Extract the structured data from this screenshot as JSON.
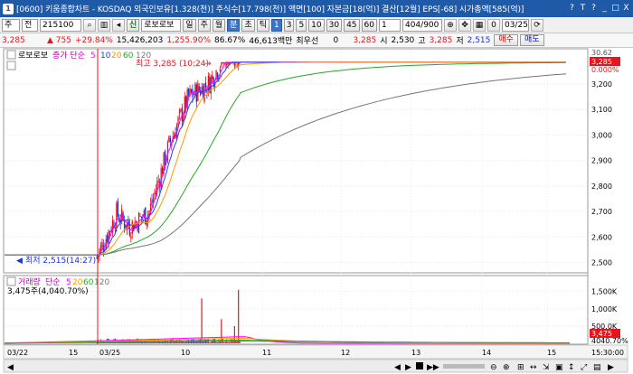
{
  "window": {
    "title": "[0600] 키움종합차트 - KOSDAQ 외국인보유[1.328(천)] 주식수[17.798(천)] 액면[100] 자본금[18(억)] 결산[12월] EPS[-68] 시가총액[585(억)]",
    "controls": [
      "?",
      "T",
      "?",
      "_",
      "□",
      "X"
    ]
  },
  "toolbar": {
    "market_label": "주",
    "mode_label": "전",
    "code": "215100",
    "search_icon": "search-icon",
    "period_icon": "bars-icon",
    "stock_name": "로보로보",
    "credit_badge": "신",
    "periods": [
      "일",
      "주",
      "월",
      "분",
      "초",
      "틱"
    ],
    "active_period": "분",
    "intervals": [
      "1",
      "3",
      "5",
      "10",
      "30",
      "45",
      "60"
    ],
    "active_interval": "1",
    "multiplier": "1",
    "count": "404/900",
    "date_checkbox": "0",
    "date": "03/25"
  },
  "quote": {
    "price": "3,285",
    "change": "▲ 755",
    "change_pct": "+29.84%",
    "volume": "15,426,203",
    "volume_pct": "1,255.90%",
    "ratio": "86.67%",
    "amount": "46,613백만",
    "priority_label": "최우선",
    "priority_value": "0",
    "current": "3,285",
    "open_label": "시",
    "open": "2,530",
    "high_label": "고",
    "high": "3,285",
    "low_label": "저",
    "low": "2,515",
    "buy_label": "매수",
    "sell_label": "매도"
  },
  "price_panel": {
    "stock_name": "로보로보",
    "ma_label": "증가 단순",
    "ma_periods": [
      "5",
      "10",
      "20",
      "60",
      "120"
    ],
    "ma_colors": [
      "#ff00ff",
      "#1f3fff",
      "#ff9900",
      "#22aa22",
      "#777777"
    ],
    "high_annotation": "최고 3,285 (10:24)",
    "low_annotation": "최저 2,515(14:27)",
    "right_labels": [
      "0.000%",
      "3,285",
      "3,200",
      "3,100",
      "3,000",
      "2,900",
      "2,800",
      "2,700",
      "2,600",
      "2,500"
    ],
    "top_right_value": "30.62",
    "current_price_tag": "3,285",
    "limit_tag": "3,285"
  },
  "volume_panel": {
    "title": "거래량",
    "ma_label": "단순",
    "ma_periods": [
      "5",
      "20",
      "60",
      "120"
    ],
    "ma_colors": [
      "#ff00ff",
      "#ff9900",
      "#22aa22",
      "#777777"
    ],
    "current_volume": "3,475주(4,040.70%)",
    "right_labels": [
      "1,500K",
      "1,000K",
      "500.0K"
    ],
    "value_tag": "3,475",
    "pct_tag": "4040.70%"
  },
  "x_axis": {
    "labels": [
      "03/22",
      "15",
      "03/25",
      "10",
      "11",
      "12",
      "13",
      "14",
      "15"
    ],
    "time": "15:30:00"
  },
  "colors": {
    "title_bg": "#1f5aa8",
    "up": "#e8141c",
    "down": "#1a35d8"
  },
  "chart_data": {
    "type": "candlestick",
    "panels": [
      {
        "name": "price",
        "ylim": [
          2470,
          3320
        ],
        "series": [
          {
            "name": "5",
            "type": "line"
          },
          {
            "name": "10",
            "type": "line"
          },
          {
            "name": "20",
            "type": "line"
          },
          {
            "name": "60",
            "type": "line"
          },
          {
            "name": "120",
            "type": "line"
          }
        ],
        "high": 3285,
        "low": 2515,
        "current": 3285
      },
      {
        "name": "volume",
        "ylim": [
          0,
          1700000
        ],
        "peaks": [
          1300000,
          1550000,
          700000
        ],
        "current": 3475
      }
    ]
  }
}
